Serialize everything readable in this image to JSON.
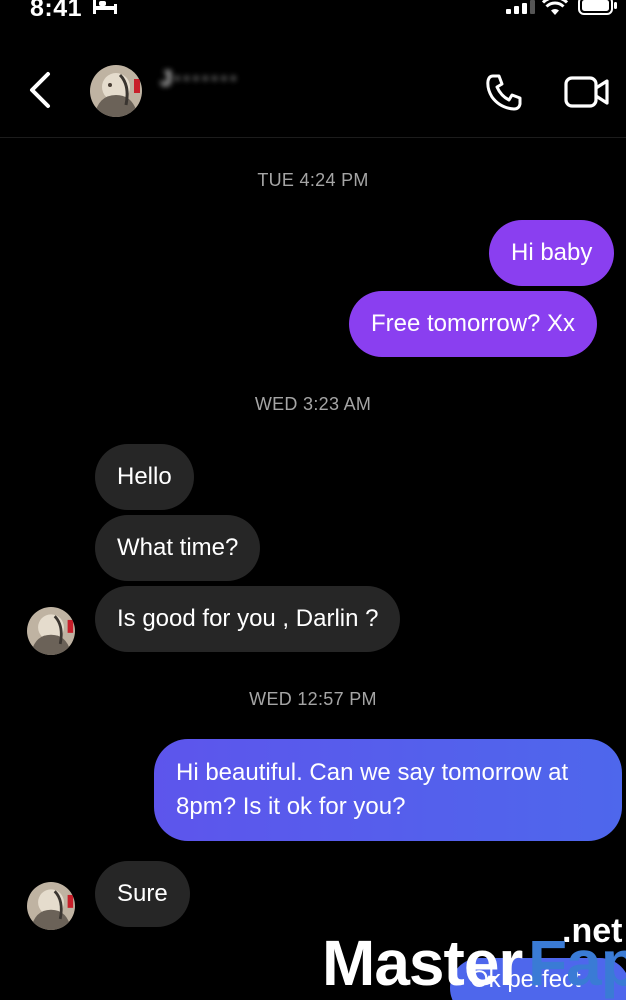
{
  "status_bar": {
    "time": "8:41",
    "icons": [
      "bed-icon",
      "signal-icon",
      "wifi-icon",
      "battery-icon"
    ]
  },
  "header": {
    "contact_name": "J·······",
    "icons": [
      "back-icon",
      "phone-icon",
      "video-icon"
    ]
  },
  "messages": [
    {
      "type": "timestamp",
      "text": "TUE 4:24 PM"
    },
    {
      "type": "outgoing",
      "text": "Hi baby"
    },
    {
      "type": "outgoing",
      "text": "Free tomorrow? Xx"
    },
    {
      "type": "timestamp",
      "text": "WED 3:23 AM"
    },
    {
      "type": "incoming",
      "text": "Hello"
    },
    {
      "type": "incoming",
      "text": "What time?"
    },
    {
      "type": "incoming",
      "text": "Is good for you , Darlin ?"
    },
    {
      "type": "timestamp",
      "text": "WED 12:57 PM"
    },
    {
      "type": "outgoing",
      "text": "Hi beautiful. Can we say tomorrow at 8pm? Is it ok for you?"
    },
    {
      "type": "incoming",
      "text": "Sure"
    },
    {
      "type": "outgoing",
      "text": "Ok perfect"
    }
  ],
  "watermark": {
    "word1": "Master",
    "word2": "Fap",
    "tld": ".net"
  },
  "colors": {
    "background": "#000000",
    "incoming_bubble": "#262626",
    "outgoing_purple": "#8a3ff0",
    "outgoing_blue": "#4e67ec",
    "timestamp": "#a5a5a5",
    "watermark_accent": "#3a7bd5"
  }
}
